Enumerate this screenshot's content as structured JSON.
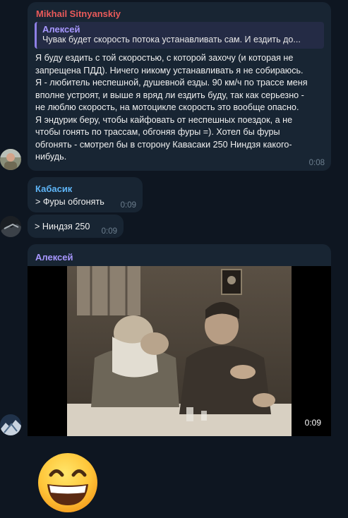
{
  "messages": {
    "m1": {
      "sender": "Mikhail Sitnyanskiy",
      "reply_to_name": "Алексей",
      "reply_to_text": "Чувак будет скорость потока устанавливать сам. И ездить до...",
      "lines": [
        "Я буду ездить с той скоростью, с которой захочу (и которая не",
        "запрещена ПДД). Ничего никому устанавливать я не собираюсь.",
        "Я - любитель неспешной, душевной езды. 90 км/ч по трассе меня",
        "вполне устроят, и выше я вряд ли ездить буду, так как серьезно -",
        "не люблю скорость, на мотоцикле скорость это вообще опасно.",
        "Я эндурик беру, чтобы кайфовать от неспешных поездок, а не",
        "чтобы гонять по трассам, обгоняя фуры =). Хотел бы фуры",
        "обгонять - смотрел бы в сторону Кавасаки 250 Ниндзя какого-",
        "нибудь."
      ],
      "time": "0:08"
    },
    "m2": {
      "sender": "Кабасик",
      "text": "> Фуры обгонять",
      "time": "0:09"
    },
    "m3": {
      "text": "> Ниндзя 250",
      "time": "0:09"
    },
    "m4": {
      "sender": "Алексей",
      "video_duration": "0:09"
    },
    "m5": {
      "emoji": "😄"
    }
  },
  "colors": {
    "background": "#0e1621",
    "bubble": "#182533",
    "name_mikhail": "#e95a5a",
    "name_kabasik": "#5eb5f7",
    "name_aleksey": "#a797ff"
  }
}
